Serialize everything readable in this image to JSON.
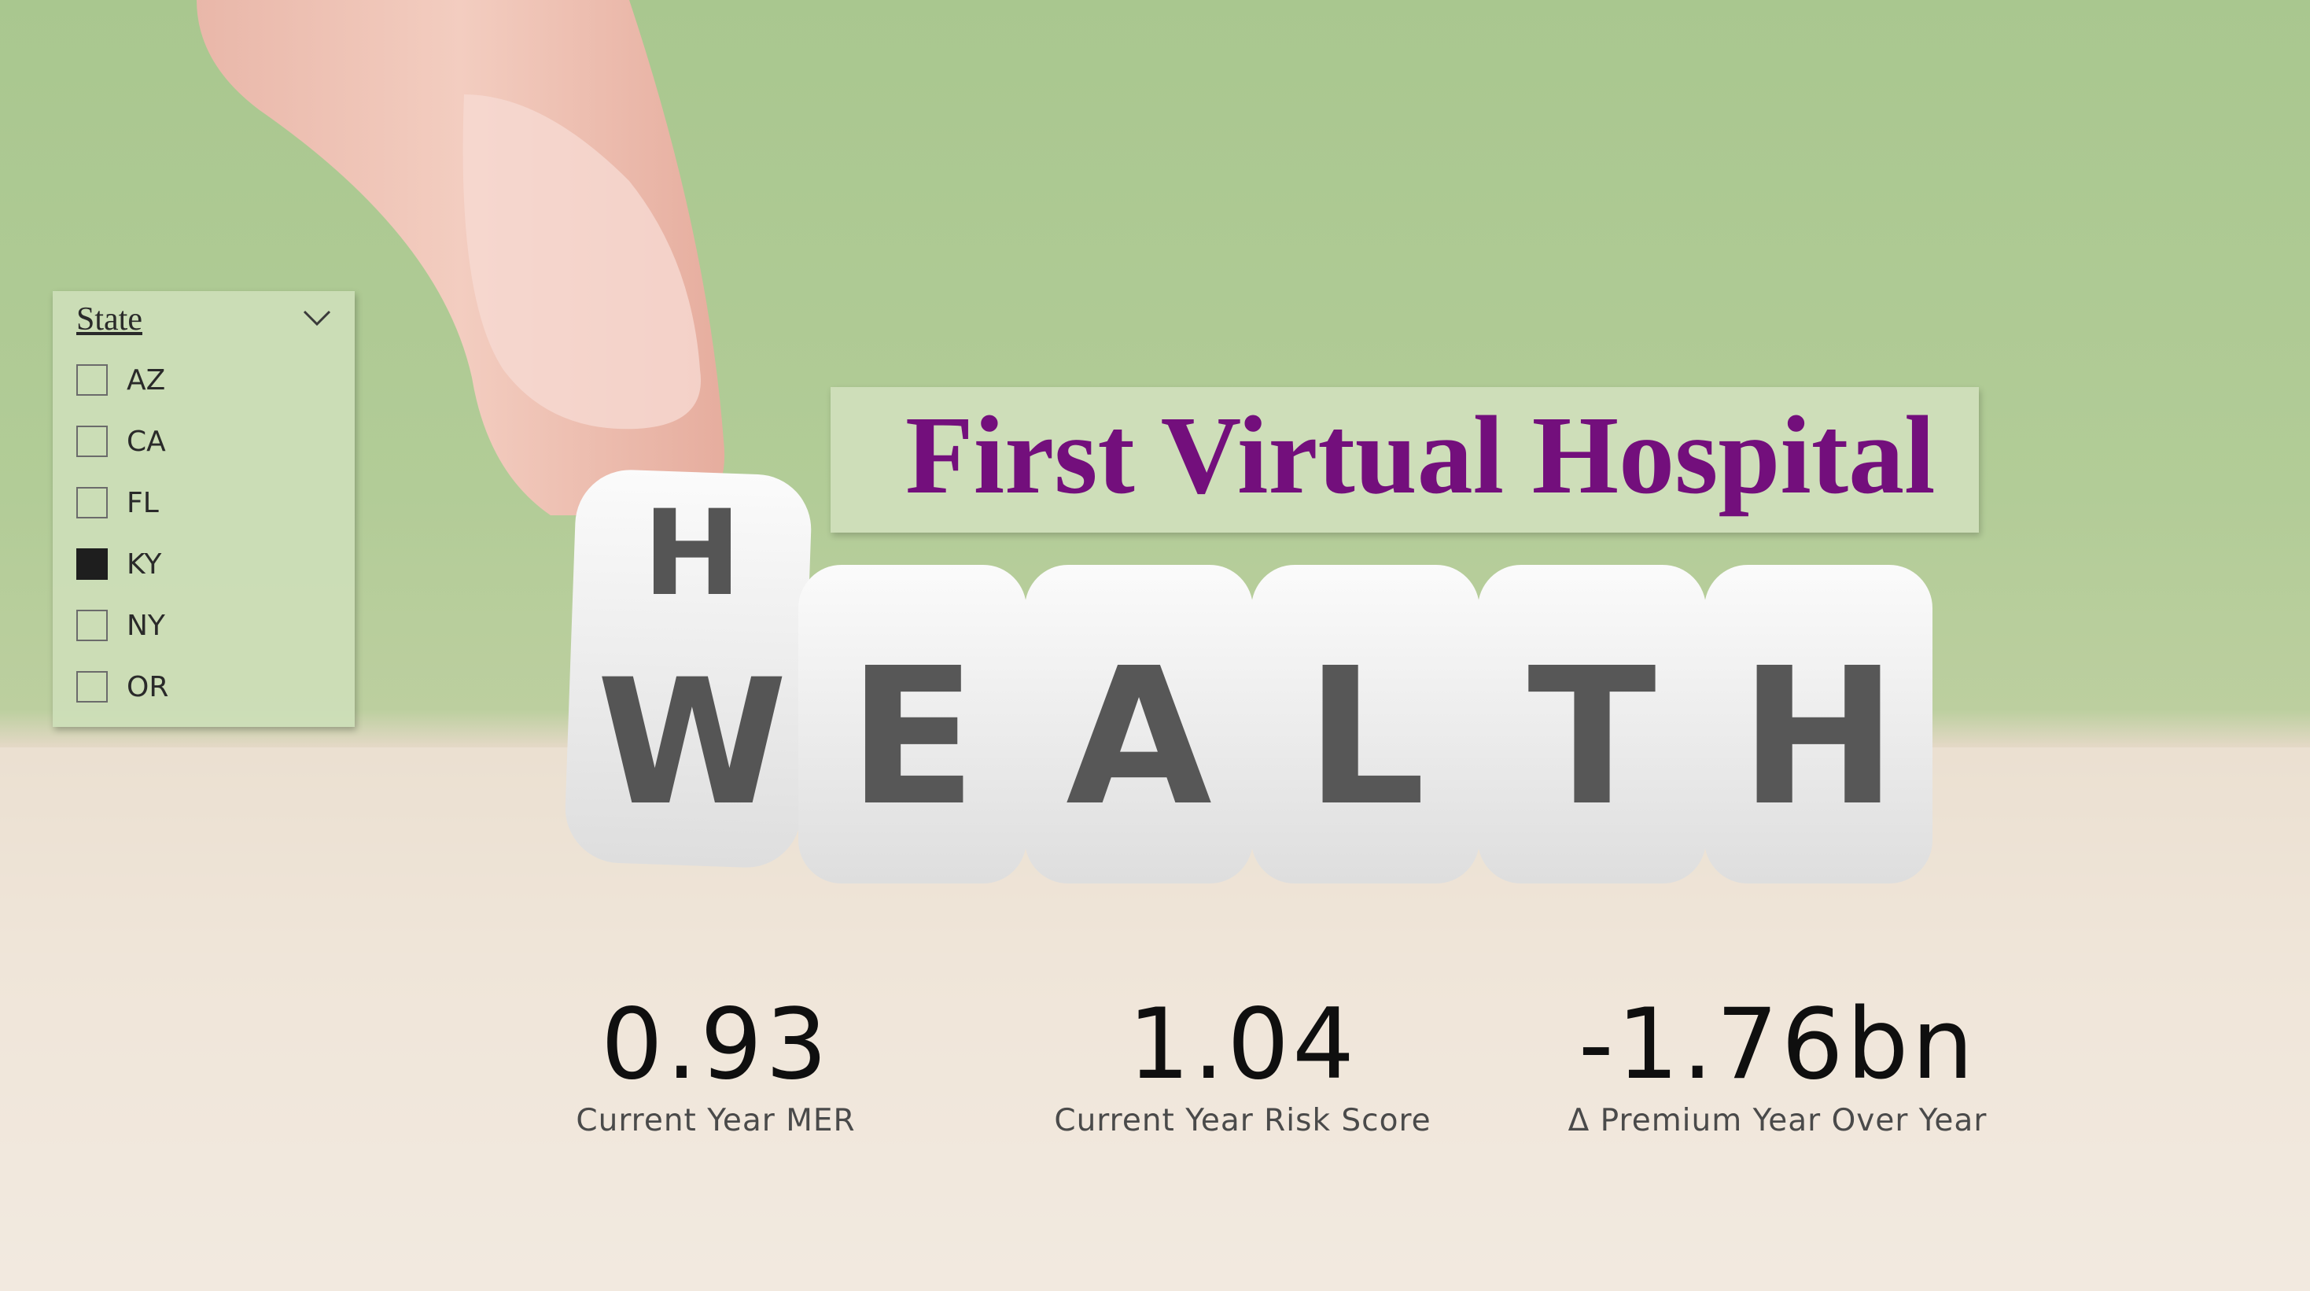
{
  "slicer": {
    "title": "State",
    "items": [
      {
        "label": "AZ",
        "checked": false
      },
      {
        "label": "CA",
        "checked": false
      },
      {
        "label": "FL",
        "checked": false
      },
      {
        "label": "KY",
        "checked": true
      },
      {
        "label": "NY",
        "checked": false
      },
      {
        "label": "OR",
        "checked": false
      }
    ]
  },
  "banner": {
    "title": "First Virtual Hospital"
  },
  "background": {
    "dice_letters_top": [
      "H"
    ],
    "dice_letters_bottom": [
      "W",
      "E",
      "A",
      "L",
      "T",
      "H"
    ]
  },
  "kpis": [
    {
      "value": "0.93",
      "label": "Current Year MER"
    },
    {
      "value": "1.04",
      "label": "Current Year Risk Score"
    },
    {
      "value": "-1.76bn",
      "label": "Δ Premium Year Over Year"
    }
  ],
  "colors": {
    "title": "#730f7c",
    "background_green": "#a9c78f",
    "checked": "#1e1e1e"
  }
}
